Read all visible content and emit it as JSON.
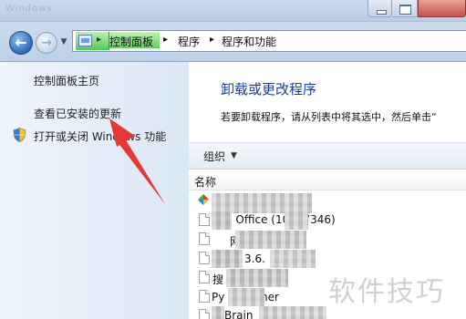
{
  "colors": {
    "title_blue": "#1c3f94",
    "nav_gradient": "#bcd0e7",
    "breadcrumb_green": "#5fd05b",
    "annotation_red": "#e53935"
  },
  "window": {
    "ghost_title": "Windows"
  },
  "address_bar": {
    "crumbs": [
      "控制面板",
      "程序",
      "程序和功能"
    ],
    "separator": "▸"
  },
  "left_pane": {
    "links": [
      "控制面板主页",
      "查看已安装的更新",
      "打开或关闭 Windows 功能"
    ]
  },
  "main": {
    "title": "卸载或更改程序",
    "description": "若要卸载程序，请从列表中将其选中，然后单击“",
    "toolbar": {
      "organize_label": "组织",
      "organize_arrow": "▼"
    },
    "column_header": "名称",
    "rows": [
      {
        "icon": "gem-icon",
        "name": ""
      },
      {
        "icon": "program-icon",
        "name": "S Office (10.1   7346)"
      },
      {
        "icon": "program-icon",
        "name": "网"
      },
      {
        "icon": "program-icon",
        "name": "3.6."
      },
      {
        "icon": "program-icon",
        "name": "搜"
      },
      {
        "icon": "program-icon",
        "name": "Py      Launcher"
      },
      {
        "icon": "program-icon",
        "name": "Brain"
      }
    ]
  },
  "watermark": {
    "text": "软件技巧"
  }
}
